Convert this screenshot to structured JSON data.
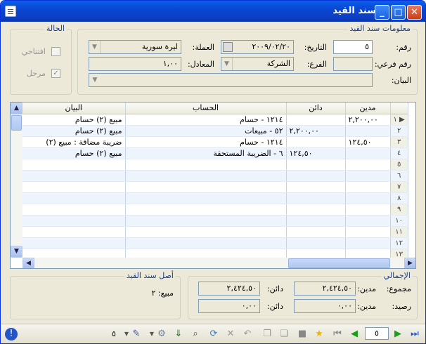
{
  "window": {
    "title": "سند القيد"
  },
  "info_group": {
    "label": "معلومات سند القيد"
  },
  "status_group": {
    "label": "الحالة",
    "opening_label": "افتتاحي",
    "posted_label": "مرحل",
    "posted_checked": true,
    "opening_checked": false
  },
  "fields": {
    "number_label": "رقم:",
    "number_value": "٥",
    "date_label": "التاريخ:",
    "date_value": "٢٠٠٩/٠٢/٢٠",
    "currency_label": "العملة:",
    "currency_value": "ليرة سورية",
    "subnumber_label": "رقم فرعي:",
    "subnumber_value": "",
    "branch_label": "الفرع:",
    "branch_value": "الشركة",
    "rate_label": "المعادل:",
    "rate_value": "١,٠٠",
    "statement_label": "البيان:",
    "statement_value": ""
  },
  "grid": {
    "headers": {
      "debit": "مدين",
      "credit": "دائن",
      "account": "الحساب",
      "statement": "البيان"
    },
    "rows": [
      {
        "n": "١",
        "debit": "٢,٢٠٠,٠٠",
        "credit": "",
        "account": "١٢١٤ - حسام",
        "statement": "مبيع (٢) حسام"
      },
      {
        "n": "٢",
        "debit": "",
        "credit": "٢,٢٠٠,٠٠",
        "account": "٥٢ - مبيعات",
        "statement": "مبيع (٢) حسام"
      },
      {
        "n": "٣",
        "debit": "١٢٤,٥٠",
        "credit": "",
        "account": "١٢١٤ - حسام",
        "statement": "ضريبة مضافة : مبيع (٢)"
      },
      {
        "n": "٤",
        "debit": "",
        "credit": "١٢٤,٥٠",
        "account": "٦ - الضريبة المستحقة",
        "statement": "مبيع (٢) حسام"
      },
      {
        "n": "٥",
        "debit": "",
        "credit": "",
        "account": "",
        "statement": ""
      },
      {
        "n": "٦",
        "debit": "",
        "credit": "",
        "account": "",
        "statement": ""
      },
      {
        "n": "٧",
        "debit": "",
        "credit": "",
        "account": "",
        "statement": ""
      },
      {
        "n": "٨",
        "debit": "",
        "credit": "",
        "account": "",
        "statement": ""
      },
      {
        "n": "٩",
        "debit": "",
        "credit": "",
        "account": "",
        "statement": ""
      },
      {
        "n": "١٠",
        "debit": "",
        "credit": "",
        "account": "",
        "statement": ""
      },
      {
        "n": "١١",
        "debit": "",
        "credit": "",
        "account": "",
        "statement": ""
      },
      {
        "n": "١٢",
        "debit": "",
        "credit": "",
        "account": "",
        "statement": ""
      },
      {
        "n": "١٣",
        "debit": "",
        "credit": "",
        "account": "",
        "statement": ""
      }
    ]
  },
  "totals_group": {
    "label": "الإجمالي",
    "sum_label": "مجموع:",
    "debit_label": "مدين:",
    "credit_label": "دائن:",
    "sum_debit": "٢,٤٢٤,٥٠",
    "sum_credit": "٢,٤٢٤,٥٠",
    "balance_label": "رصيد:",
    "balance_debit": "٠,٠٠",
    "balance_credit": "٠,٠٠"
  },
  "origin_group": {
    "label": "أصل سند القيد",
    "value": "مبيع: ٢"
  },
  "toolbar": {
    "page": "٥",
    "count": "٥"
  }
}
